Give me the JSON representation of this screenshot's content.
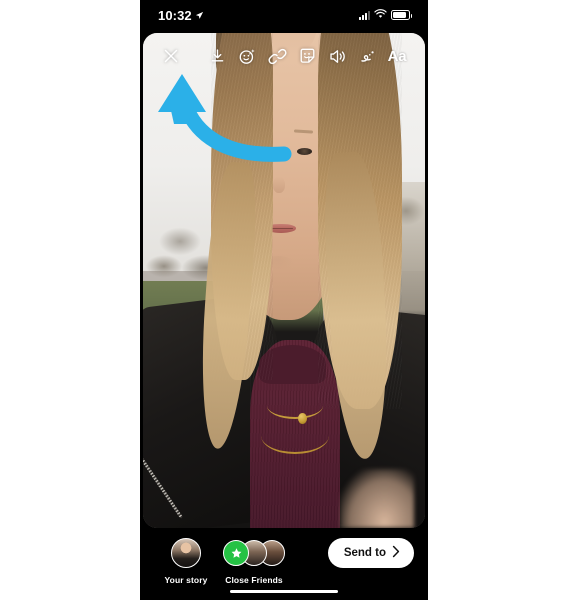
{
  "device": {
    "status_bar": {
      "time": "10:32",
      "location_icon": "location-arrow-icon",
      "signal_icon": "cellular-signal-icon",
      "wifi_icon": "wifi-icon",
      "battery_icon": "battery-icon"
    },
    "home_indicator": "home-indicator"
  },
  "editor": {
    "toolbar": {
      "close_label": "Close",
      "items": [
        {
          "name": "close-icon",
          "label": "Close"
        },
        {
          "name": "download-icon",
          "label": "Save"
        },
        {
          "name": "effects-icon",
          "label": "Effects"
        },
        {
          "name": "link-icon",
          "label": "Link"
        },
        {
          "name": "sticker-icon",
          "label": "Sticker"
        },
        {
          "name": "sound-icon",
          "label": "Sound"
        },
        {
          "name": "draw-icon",
          "label": "Draw"
        },
        {
          "name": "text-icon",
          "label": "Aa"
        }
      ],
      "text_icon_label": "Aa"
    },
    "annotation": {
      "type": "curved-arrow",
      "points_to": "link-icon",
      "color": "#2BB0E8"
    },
    "media": {
      "description": "Selfie photo of a woman with long blonde hair in a park, wearing a black leather jacket, burgundy turtleneck and gold necklaces"
    }
  },
  "share_bar": {
    "destinations": [
      {
        "name": "your-story",
        "label": "Your story",
        "badge": null
      },
      {
        "name": "close-friends",
        "label": "Close Friends",
        "badge": "star"
      }
    ],
    "send_to": {
      "label": "Send to",
      "chevron": "chevron-right-icon"
    }
  },
  "colors": {
    "accent_blue": "#2BB0E8",
    "close_friends_green": "#25C244",
    "frame_black": "#000000",
    "button_white": "#FFFFFF"
  }
}
